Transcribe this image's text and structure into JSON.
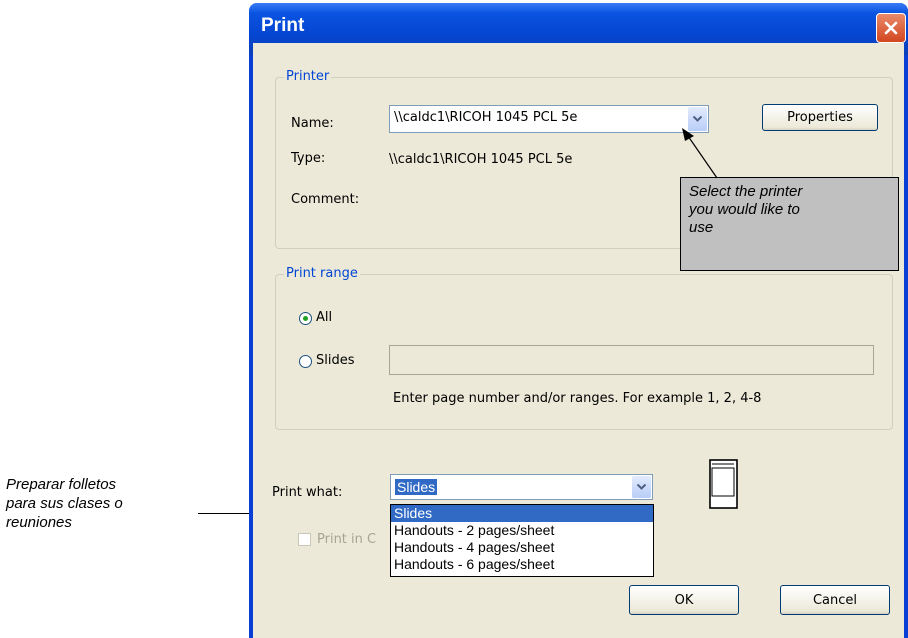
{
  "left_annotation": {
    "lines": [
      "Preparar folletos",
      "para sus clases o",
      "reuniones"
    ]
  },
  "window": {
    "title": "Print",
    "close_icon": "close-x-icon"
  },
  "printer_group": {
    "label": "Printer",
    "name_label": "Name:",
    "name_value": "\\\\caldc1\\RICOH 1045 PCL 5e",
    "type_label": "Type:",
    "type_value": "\\\\caldc1\\RICOH 1045 PCL 5e",
    "comment_label": "Comment:",
    "properties_button": "Properties"
  },
  "callout": {
    "lines": [
      "Select the printer",
      "you would like to",
      "use"
    ]
  },
  "print_range_group": {
    "label": "Print range",
    "all_label": "All",
    "slides_label": "Slides",
    "slides_value": "",
    "selected": "All",
    "hint": "Enter page number and/or ranges.  For example  1, 2, 4-8"
  },
  "print_what": {
    "label": "Print what:",
    "value": "Slides",
    "options": [
      "Slides",
      "Handouts - 2 pages/sheet",
      "Handouts - 4 pages/sheet",
      "Handouts - 6 pages/sheet"
    ],
    "selected_index": 0
  },
  "print_in_color": {
    "label": "Print in C",
    "checked": false
  },
  "buttons": {
    "ok": "OK",
    "cancel": "Cancel"
  }
}
